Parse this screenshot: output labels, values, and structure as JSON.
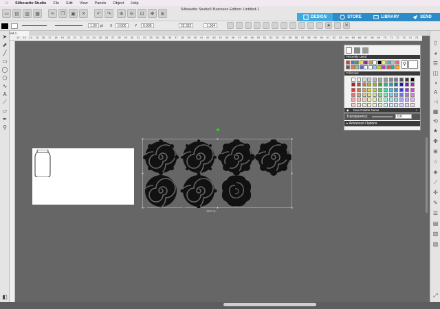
{
  "menubar": {
    "items": [
      "Silhouette Studio",
      "File",
      "Edit",
      "View",
      "Panels",
      "Object",
      "Help"
    ]
  },
  "window": {
    "title": "Silhouette Studio® Business Edition: Untitled-1"
  },
  "tabs": [
    {
      "label": "DESIGN",
      "icon": "design-icon",
      "active": true
    },
    {
      "label": "STORE",
      "icon": "store-icon",
      "active": false
    },
    {
      "label": "LIBRARY",
      "icon": "library-icon",
      "active": false
    },
    {
      "label": "SEND",
      "icon": "send-icon",
      "active": false
    }
  ],
  "toolbar2": {
    "line_width": "1.00",
    "line_unit": "pt",
    "x_label": "X",
    "x_value": "0.000",
    "y_label": "Y",
    "y_value": "0.000",
    "w_value": "22.322",
    "h_value": "-1.504"
  },
  "document": {
    "tab_label": "Untitled-1"
  },
  "ruler": {
    "top_marks": [
      "12",
      "13",
      "14",
      "15",
      "16",
      "17",
      "18",
      "19",
      "20",
      "21",
      "22",
      "23",
      "24",
      "25",
      "26",
      "27",
      "28",
      "29",
      "30",
      "31",
      "32",
      "33",
      "34",
      "35",
      "36",
      "37",
      "38",
      "39",
      "40",
      "41",
      "42",
      "43",
      "44",
      "45",
      "46",
      "47",
      "48",
      "49",
      "50",
      "51",
      "52",
      "53",
      "54",
      "55",
      "56",
      "57",
      "58",
      "59",
      "60",
      "61",
      "62",
      "63",
      "64",
      "65",
      "66",
      "67",
      "68",
      "69",
      "70",
      "71",
      "72",
      "73",
      "74",
      "75"
    ]
  },
  "canvas": {
    "dimension_label": "18.5 in"
  },
  "panel": {
    "recently_used": "Recently Used",
    "fill_color": "Fill Color",
    "new_palette": "New Palette Name",
    "transparency_label": "Transparency",
    "transparency_value": "0.0",
    "advanced_options": "Advanced Options"
  },
  "colors": {
    "accent": "#3fa9e0",
    "tab_bg": "#2d8cc8",
    "canvas_bg": "#666666",
    "flower": "#111111"
  }
}
